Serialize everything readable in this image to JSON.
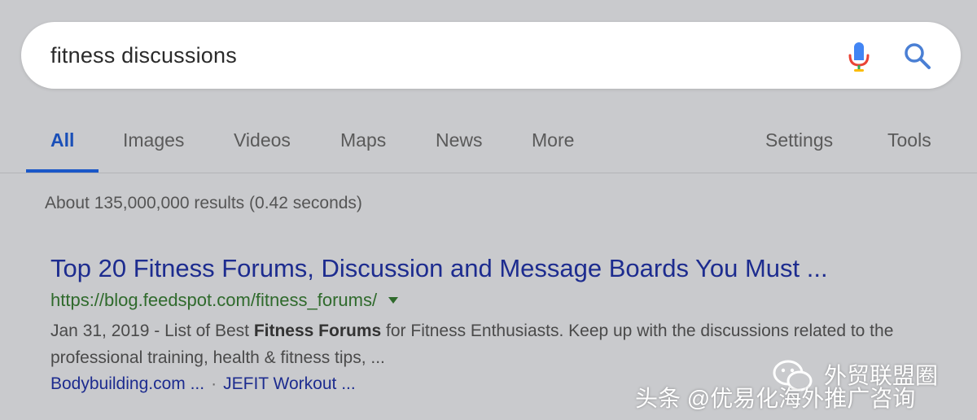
{
  "search": {
    "query": "fitness discussions"
  },
  "tabs": {
    "items": [
      "All",
      "Images",
      "Videos",
      "Maps",
      "News",
      "More"
    ],
    "right": [
      "Settings",
      "Tools"
    ],
    "active": "All"
  },
  "results_stats": "About 135,000,000 results (0.42 seconds)",
  "result": {
    "title": "Top 20 Fitness Forums, Discussion and Message Boards You Must ...",
    "url": "https://blog.feedspot.com/fitness_forums/",
    "date": "Jan 31, 2019",
    "snippet_pre": " - List of Best ",
    "snippet_bold": "Fitness Forums",
    "snippet_post": " for Fitness Enthusiasts. Keep up with the discussions related to the professional training, health & fitness tips, ...",
    "sitelinks": [
      "Bodybuilding.com ...",
      "JEFIT Workout ..."
    ],
    "sitelink_separator": "·"
  },
  "watermark": {
    "brand": "外贸联盟圈",
    "line": "头条 @优易化海外推广咨询"
  },
  "colors": {
    "background": "#c9cacd",
    "link": "#1d2c8f",
    "url": "#2f6a2c",
    "active_tab": "#1a4fb8"
  }
}
